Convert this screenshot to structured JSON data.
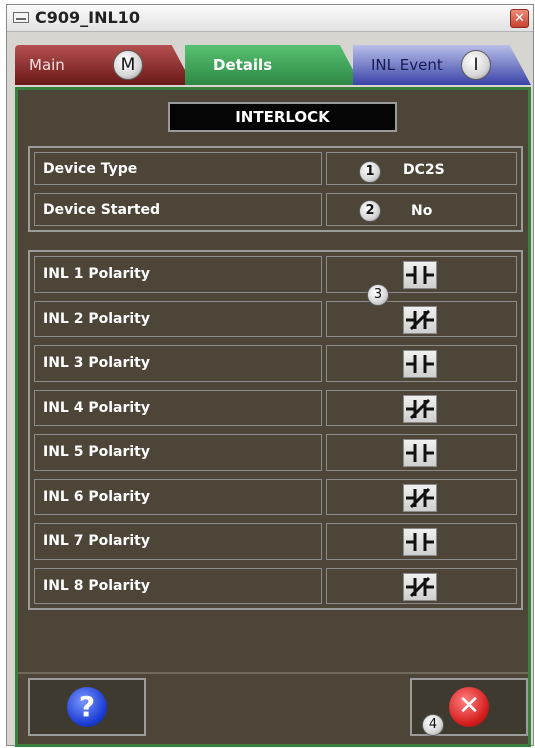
{
  "window": {
    "title": "C909_INL10",
    "close_glyph": "✕"
  },
  "tabs": [
    {
      "label": "Main",
      "badge": "M",
      "color": "#7a1f1f"
    },
    {
      "label": "Details",
      "color": "#3a9c52"
    },
    {
      "label": "INL Event",
      "badge": "I",
      "color": "#3a43a8"
    }
  ],
  "section_title": "INTERLOCK",
  "info": [
    {
      "label": "Device Type",
      "value": "DC2S",
      "badge": "1"
    },
    {
      "label": "Device Started",
      "value": "No",
      "badge": "2"
    }
  ],
  "polarity_badge": "3",
  "polarities": [
    {
      "label": "INL 1 Polarity",
      "icon": "normally-open-contact-icon"
    },
    {
      "label": "INL 2 Polarity",
      "icon": "normally-closed-contact-icon"
    },
    {
      "label": "INL 3 Polarity",
      "icon": "normally-open-contact-icon"
    },
    {
      "label": "INL 4 Polarity",
      "icon": "normally-closed-contact-icon"
    },
    {
      "label": "INL 5 Polarity",
      "icon": "normally-open-contact-icon"
    },
    {
      "label": "INL 6 Polarity",
      "icon": "normally-closed-contact-icon"
    },
    {
      "label": "INL 7 Polarity",
      "icon": "normally-open-contact-icon"
    },
    {
      "label": "INL 8 Polarity",
      "icon": "normally-closed-contact-icon"
    }
  ],
  "footer": {
    "help_glyph": "?",
    "close_glyph": "✕",
    "close_badge": "4"
  },
  "colors": {
    "panel_bg": "#4c4538",
    "panel_border": "#3a7f3d",
    "grid_border": "#9b9b9b"
  }
}
